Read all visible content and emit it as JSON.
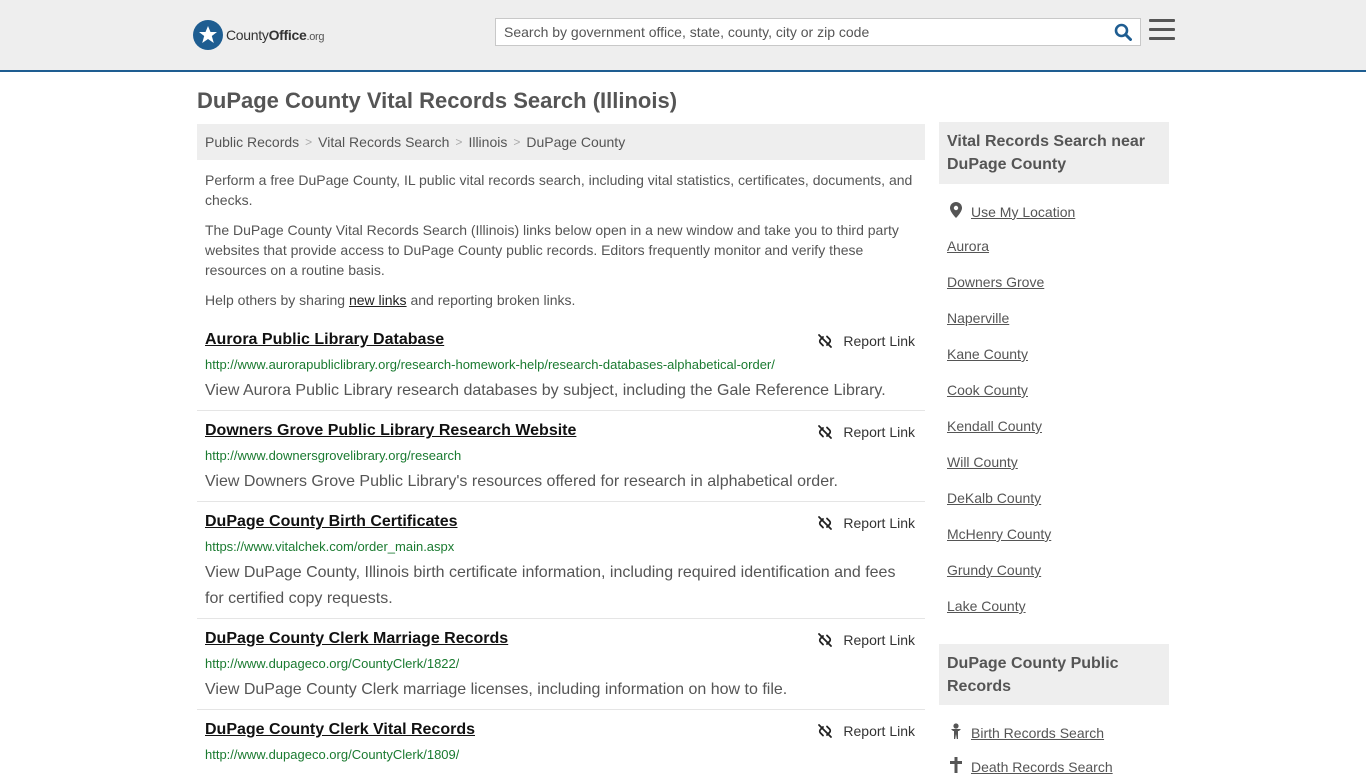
{
  "header": {
    "logo_prefix": "County",
    "logo_bold": "Office",
    "logo_suffix": ".org",
    "search_placeholder": "Search by government office, state, county, city or zip code"
  },
  "page_title": "DuPage County Vital Records Search (Illinois)",
  "breadcrumb": [
    "Public Records",
    "Vital Records Search",
    "Illinois",
    "DuPage County"
  ],
  "intro": {
    "p1": "Perform a free DuPage County, IL public vital records search, including vital statistics, certificates, documents, and checks.",
    "p2": "The DuPage County Vital Records Search (Illinois) links below open in a new window and take you to third party websites that provide access to DuPage County public records. Editors frequently monitor and verify these resources on a routine basis.",
    "p3_before": "Help others by sharing ",
    "p3_link": "new links",
    "p3_after": " and reporting broken links."
  },
  "report_label": "Report Link",
  "results": [
    {
      "title": "Aurora Public Library Database",
      "url": "http://www.aurorapubliclibrary.org/research-homework-help/research-databases-alphabetical-order/",
      "desc": "View Aurora Public Library research databases by subject, including the Gale Reference Library."
    },
    {
      "title": "Downers Grove Public Library Research Website",
      "url": "http://www.downersgrovelibrary.org/research",
      "desc": "View Downers Grove Public Library's resources offered for research in alphabetical order."
    },
    {
      "title": "DuPage County Birth Certificates",
      "url": "https://www.vitalchek.com/order_main.aspx",
      "desc": "View DuPage County, Illinois birth certificate information, including required identification and fees for certified copy requests."
    },
    {
      "title": "DuPage County Clerk Marriage Records",
      "url": "http://www.dupageco.org/CountyClerk/1822/",
      "desc": "View DuPage County Clerk marriage licenses, including information on how to file."
    },
    {
      "title": "DuPage County Clerk Vital Records",
      "url": "http://www.dupageco.org/CountyClerk/1809/",
      "desc": ""
    }
  ],
  "sidebar": {
    "nearby_heading": "Vital Records Search near DuPage County",
    "use_location": "Use My Location",
    "nearby": [
      "Aurora",
      "Downers Grove",
      "Naperville",
      "Kane County",
      "Cook County",
      "Kendall County",
      "Will County",
      "DeKalb County",
      "McHenry County",
      "Grundy County",
      "Lake County"
    ],
    "records_heading": "DuPage County Public Records",
    "records": [
      "Birth Records Search",
      "Death Records Search"
    ]
  }
}
